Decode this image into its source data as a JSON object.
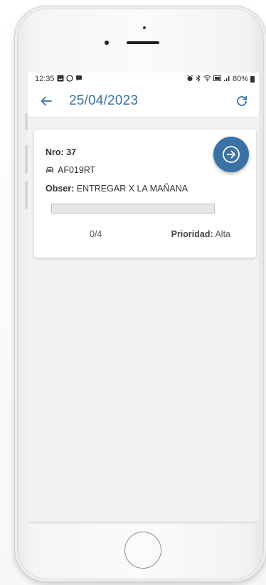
{
  "status_bar": {
    "time": "12:35",
    "battery": "80%"
  },
  "header": {
    "title": "25/04/2023",
    "back_icon": "arrow-left-icon",
    "refresh_icon": "refresh-icon"
  },
  "card": {
    "nro_label": "Nro:",
    "nro_value": "37",
    "vehicle_icon": "car-icon",
    "vehicle": "AF019RT",
    "obs_label": "Obser:",
    "obs_value": "ENTREGAR X LA MAÑANA",
    "progress_text": "0/4",
    "progress_fraction": 0,
    "priority_label": "Prioridad:",
    "priority_value": "Alta",
    "action_icon": "arrow-right-circle-icon"
  },
  "colors": {
    "accent": "#3a72a5",
    "background": "#f2f2f2"
  }
}
